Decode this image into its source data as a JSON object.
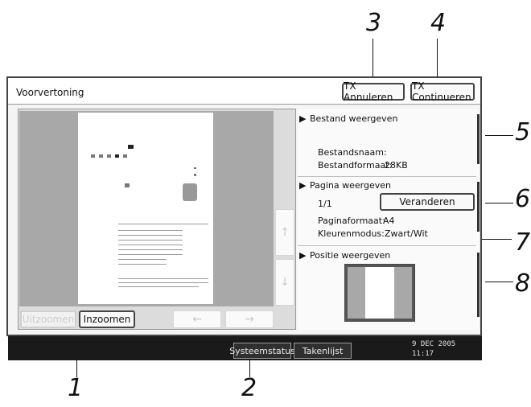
{
  "callouts": {
    "c1": "1",
    "c2": "2",
    "c3": "3",
    "c4": "4",
    "c5": "5",
    "c6": "6",
    "c7": "7",
    "c8": "8"
  },
  "window": {
    "title": "Voorvertoning"
  },
  "header_buttons": {
    "cancel_tx": "TX Annuleren",
    "continue_tx": "TX Continueren"
  },
  "zoom": {
    "zoom_out": "Uitzoomen",
    "zoom_in": "Inzoomen"
  },
  "icons": {
    "prev": "left-arrow-icon",
    "next": "right-arrow-icon",
    "up": "up-arrow-icon",
    "down": "down-arrow-icon",
    "section": "triangle-right-icon"
  },
  "file_section": {
    "title": "Bestand weergeven",
    "name_label": "Bestandsnaam:",
    "format_label": "Bestandformaat:",
    "format_value": "28KB"
  },
  "page_section": {
    "title": "Pagina weergeven",
    "counter": "1/1",
    "change_button": "Veranderen",
    "size_label": "Paginaformaat:",
    "size_value": "A4",
    "color_label": "Kleurenmodus:",
    "color_value": "Zwart/Wit"
  },
  "position_section": {
    "title": "Positie weergeven"
  },
  "status_bar": {
    "system_status": "Systeemstatus",
    "job_list": "Takenlijst",
    "date": "9 DEC  2005",
    "time": "11:17"
  },
  "arrows": {
    "left": "←",
    "right": "→",
    "up": "↑",
    "down": "↓",
    "triangle": "▶"
  }
}
